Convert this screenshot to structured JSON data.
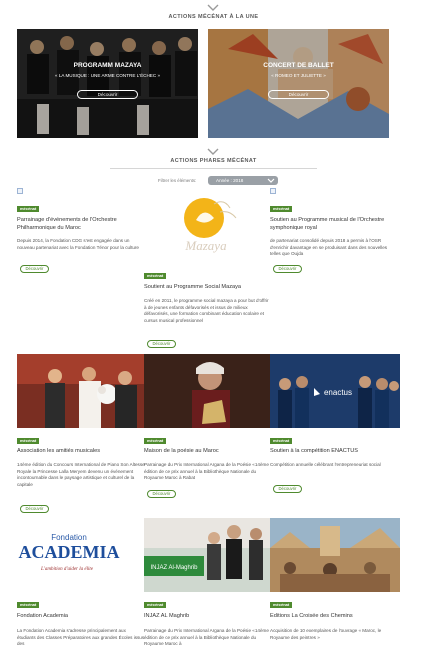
{
  "sections": {
    "top_title": "ACTIONS MÉCÉNAT À LA UNE",
    "phares_title": "ACTIONS PHARES MÉCÉNAT"
  },
  "heroes": [
    {
      "title": "PROGRAMM MAZAYA",
      "subtitle": "« LA MUSIQUE : UNE ARME CONTRE L'ÉCHEC »",
      "button": "Découvrir"
    },
    {
      "title": "CONCERT DE BALLET",
      "subtitle": "« ROMEO ET JULIETTE »",
      "button": "Découvrir"
    }
  ],
  "filter": {
    "label": "Filtrer les éléments:",
    "selected": "Année : 2018"
  },
  "tag_label": "mécénat",
  "cards": [
    {
      "title": "Parrainage d'événements de l'Orchestre Philharmonique du Maroc",
      "body": "Depuis 2014, la Fondation CDG s'est engagée dans un nouveau partenariat avec la Fondation Ténor pour la culture",
      "button": "Découvrir"
    },
    {
      "title": "Soutient au Programme Social Mazaya",
      "body": "Créé en 2011, le programme social mazaya a pour but d'offrir à de jeunes enfants défavorisés et issus de milieux défavorisés, une formation combinant éducation scolaire et cursus musical professionnel",
      "button": "Découvrir",
      "image_text": "Mazaya"
    },
    {
      "title": "Soutien au Programme musical de l'Orchestre symphonique royal",
      "body": "de partenariat consolidé depuis 2018 a permis à l'OSR d'enrichir davantage en se produisant dans des nouvelles telles que Oujda",
      "button": "Découvrir"
    },
    {
      "title": "Association les amitiés musicales",
      "body": "14ème édition du Concours International de Piano Son Altesse Royale la Princesse Lalla Meryem devenu un événement incontournable dans le paysage artistique et culturel de la capitale",
      "button": "Découvrir"
    },
    {
      "title": "Maison de la poésie au Maroc",
      "body": "Parrainage du Prix International Argana de la Poésie «14ème édition de ce prix annuel à la Bibliothèque Nationale du Royaume Maroc à Rabat",
      "button": "Découvrir"
    },
    {
      "title": "Soutien à la compétition ENACTUS",
      "body": "Compétition annuelle célébrant l'entrepreneuriat social",
      "button": "Découvrir",
      "image_text": "enactus"
    },
    {
      "title": "Fondation Academia",
      "body": "La Fondation Academia s'adresse principalement aux étudiants des Classes Préparatoires aux grandes Écoles issus des",
      "image_text_top": "Fondation",
      "image_text_main": "ACADEMIA",
      "image_text_sub": "L'ambition d'aider la élite"
    },
    {
      "title": "INJAZ AL Maghrib",
      "body": "Parrainage du Prix International Argana de la Poésie «14ème édition de ce prix annuel à la Bibliothèque Nationale du Royaume Maroc à",
      "image_text": "INJAZ Al-Maghrib"
    },
    {
      "title": "Editions La Croisée des Chemins",
      "body": "Acquisition de 10 exemplaires de l'ouvrage « Maroc, le Royaume des peintres »"
    }
  ],
  "colors": {
    "accent_green": "#4f8a2e",
    "filter_grey": "#9aa0a6"
  }
}
